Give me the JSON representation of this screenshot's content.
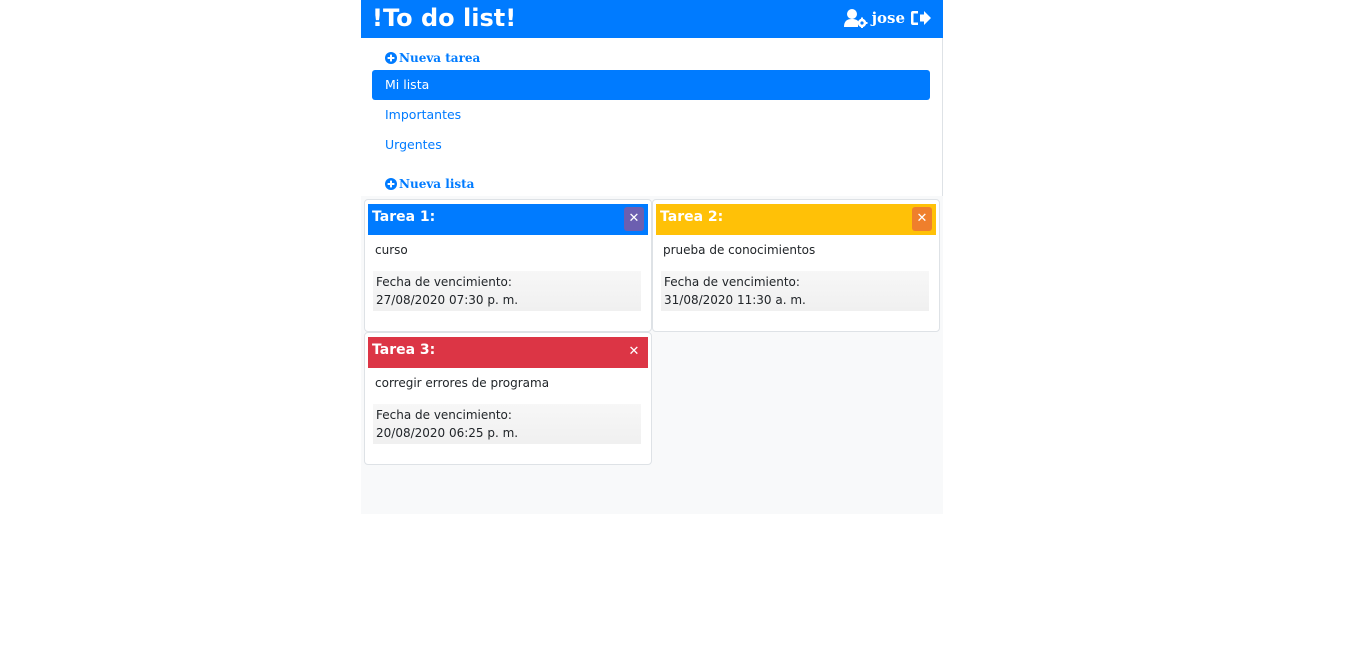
{
  "header": {
    "brand": "!To do list!",
    "username": "jose",
    "user_icon": "user-cog-icon",
    "logout_icon": "sign-out-icon",
    "color": "#007bff"
  },
  "sidebar": {
    "new_task_label": "Nueva tarea",
    "new_list_label": "Nueva lista",
    "add_icon": "plus-circle-icon",
    "items": [
      {
        "label": "Mi lista",
        "active": true
      },
      {
        "label": "Importantes",
        "active": false
      },
      {
        "label": "Urgentes",
        "active": false
      }
    ]
  },
  "tasks": [
    {
      "title": "Tarea 1:",
      "description": "curso",
      "due_label": "Fecha de vencimiento:",
      "due_value": "27/08/2020 07:30 p. m.",
      "color": "#007bff",
      "close_bg": "#6c5fb0",
      "close_icon": "close-icon"
    },
    {
      "title": "Tarea 2:",
      "description": "prueba de conocimientos",
      "due_label": "Fecha de vencimiento:",
      "due_value": "31/08/2020 11:30 a. m.",
      "color": "#ffc107",
      "close_bg": "#ef7f2c",
      "close_icon": "close-icon"
    },
    {
      "title": "Tarea 3:",
      "description": "corregir errores de programa",
      "due_label": "Fecha de vencimiento:",
      "due_value": "20/08/2020 06:25 p. m.",
      "color": "#dc3545",
      "close_bg": "#dc3545",
      "close_icon": "close-icon"
    }
  ]
}
